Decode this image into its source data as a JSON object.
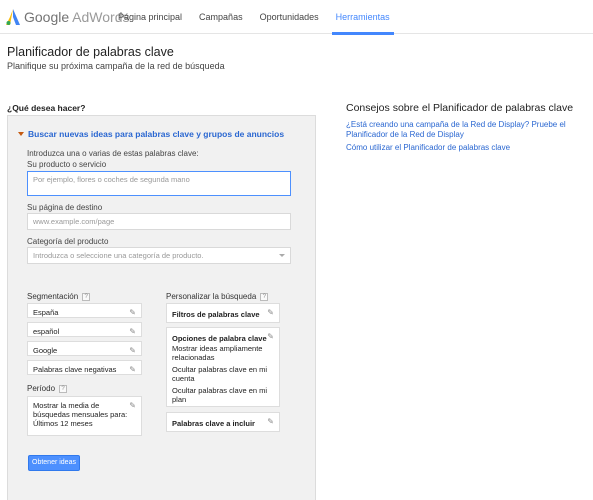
{
  "brand": {
    "google": "Google",
    "product": "AdWords"
  },
  "nav": [
    {
      "label": "Página principal",
      "active": false
    },
    {
      "label": "Campañas",
      "active": false
    },
    {
      "label": "Oportunidades",
      "active": false
    },
    {
      "label": "Herramientas",
      "active": true
    }
  ],
  "header": {
    "title": "Planificador de palabras clave",
    "subtitle": "Planifique su próxima campaña de la red de búsqueda"
  },
  "question": "¿Qué desea hacer?",
  "search_section": {
    "title": "Buscar nuevas ideas para palabras clave y grupos de anuncios",
    "intro": "Introduzca una o varias de estas palabras clave:",
    "product_label": "Su producto o servicio",
    "product_placeholder": "Por ejemplo, flores o coches de segunda mano",
    "landing_label": "Su página de destino",
    "landing_placeholder": "www.example.com/page",
    "category_label": "Categoría del producto",
    "category_placeholder": "Introduzca o seleccione una categoría de producto."
  },
  "targeting": {
    "label": "Segmentación",
    "help": "?",
    "items": [
      "España",
      "español",
      "Google",
      "Palabras clave negativas"
    ]
  },
  "period": {
    "label": "Período",
    "help": "?",
    "lines": [
      "Mostrar la media de",
      "búsquedas mensuales para:",
      "Últimos 12 meses"
    ]
  },
  "customize": {
    "label": "Personalizar la búsqueda",
    "help": "?",
    "keyword_filters": "Filtros de palabras clave",
    "keyword_options": {
      "title": "Opciones de palabra clave",
      "lines": [
        "Mostrar ideas ampliamente",
        "relacionadas",
        "Ocultar palabras clave en mi",
        "cuenta",
        "Ocultar palabras clave en mi",
        "plan"
      ]
    },
    "include": "Palabras clave a incluir"
  },
  "submit_label": "Obtener ideas",
  "tips": {
    "title": "Consejos sobre el Planificador de palabras clave",
    "link1_line1": "¿Está creando una campaña de la Red de Display? Pruebe el",
    "link1_line2": "Planificador de la Red de Display",
    "link2": "Cómo utilizar el Planificador de palabras clave"
  },
  "colors": {
    "accent": "#4387fd",
    "link": "#2a67d1",
    "button": "#4d90fe"
  },
  "icons": {
    "edit": "pencil-icon",
    "expand": "triangle-down-icon",
    "help": "help-icon",
    "logo": "adwords-logo-icon"
  }
}
